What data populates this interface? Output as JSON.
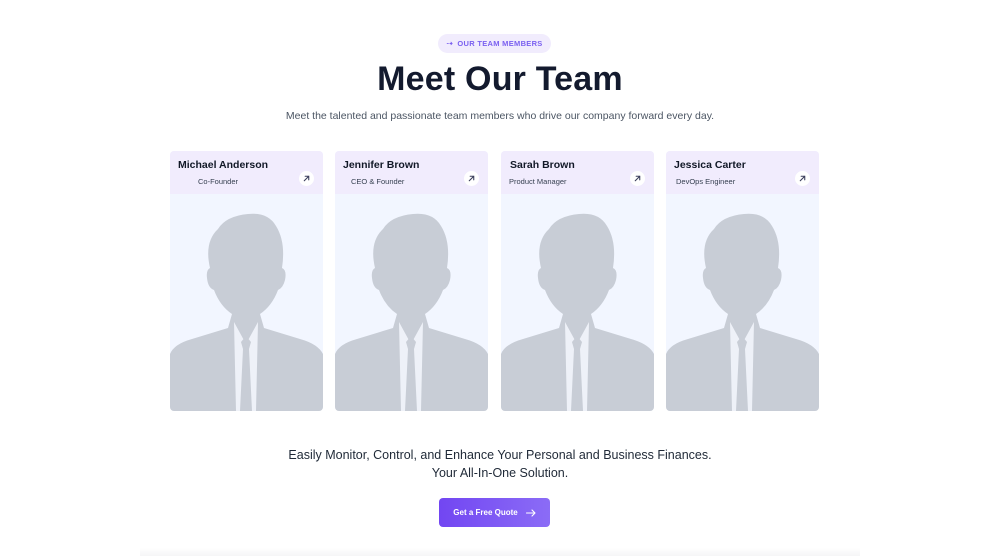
{
  "header": {
    "badge_label": "OUR TEAM MEMBERS",
    "title": "Meet Our Team",
    "subtitle": "Meet the talented and passionate team members who drive our company forward every day."
  },
  "team": [
    {
      "name": "Michael Anderson",
      "role": "Co-Founder"
    },
    {
      "name": "Jennifer Brown",
      "role": "CEO & Founder"
    },
    {
      "name": "Sarah Brown",
      "role": "Product Manager"
    },
    {
      "name": "Jessica Carter",
      "role": "DevOps Engineer"
    }
  ],
  "cta_section": {
    "tagline_line1": "Easily Monitor, Control, and Enhance Your Personal and Business Finances.",
    "tagline_line2": "Your All-In-One Solution.",
    "button_label": "Get a Free Quote"
  },
  "colors": {
    "accent": "#7246f2",
    "badge_bg": "#f1ecfd",
    "card_bg": "#f2f6ff",
    "silhouette": "#c8cdd6"
  },
  "icons": {
    "badge": "arrow-right-icon",
    "card_link": "arrow-up-right-icon",
    "cta": "arrow-right-icon",
    "avatar": "person-silhouette-icon"
  }
}
